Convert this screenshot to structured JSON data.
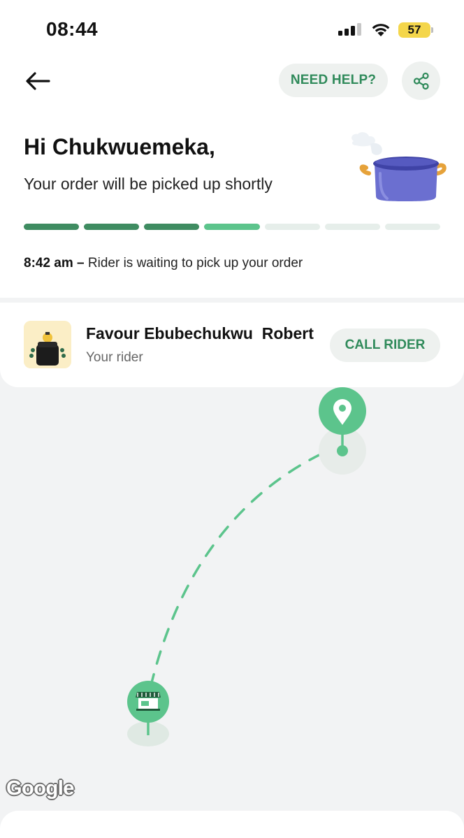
{
  "status_bar": {
    "time": "08:44",
    "battery": "57"
  },
  "nav": {
    "help_label": "NEED HELP?"
  },
  "order": {
    "greeting": "Hi Chukwuemeka,",
    "subtitle": "Your order will be picked up shortly",
    "progress": {
      "total_steps": 7,
      "completed_steps": 3,
      "active_step": 4
    },
    "status_time": "8:42 am",
    "status_separator": " – ",
    "status_message": "Rider is waiting to pick up your order"
  },
  "rider": {
    "name": "Favour Ebubechukwu  Robert",
    "role": "Your rider",
    "call_label": "CALL RIDER"
  },
  "map": {
    "attribution": "Google"
  },
  "colors": {
    "accent": "#2f8a5a",
    "progress_done": "#3f8c61",
    "progress_active": "#5cc48c",
    "marker": "#5cc48c"
  }
}
